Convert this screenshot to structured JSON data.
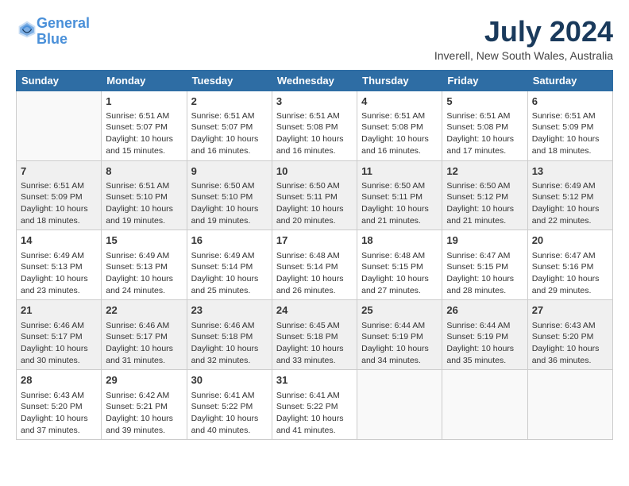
{
  "logo": {
    "line1": "General",
    "line2": "Blue"
  },
  "title": "July 2024",
  "location": "Inverell, New South Wales, Australia",
  "days_header": [
    "Sunday",
    "Monday",
    "Tuesday",
    "Wednesday",
    "Thursday",
    "Friday",
    "Saturday"
  ],
  "weeks": [
    [
      {
        "day": "",
        "info": ""
      },
      {
        "day": "1",
        "info": "Sunrise: 6:51 AM\nSunset: 5:07 PM\nDaylight: 10 hours\nand 15 minutes."
      },
      {
        "day": "2",
        "info": "Sunrise: 6:51 AM\nSunset: 5:07 PM\nDaylight: 10 hours\nand 16 minutes."
      },
      {
        "day": "3",
        "info": "Sunrise: 6:51 AM\nSunset: 5:08 PM\nDaylight: 10 hours\nand 16 minutes."
      },
      {
        "day": "4",
        "info": "Sunrise: 6:51 AM\nSunset: 5:08 PM\nDaylight: 10 hours\nand 16 minutes."
      },
      {
        "day": "5",
        "info": "Sunrise: 6:51 AM\nSunset: 5:08 PM\nDaylight: 10 hours\nand 17 minutes."
      },
      {
        "day": "6",
        "info": "Sunrise: 6:51 AM\nSunset: 5:09 PM\nDaylight: 10 hours\nand 18 minutes."
      }
    ],
    [
      {
        "day": "7",
        "info": "Sunrise: 6:51 AM\nSunset: 5:09 PM\nDaylight: 10 hours\nand 18 minutes."
      },
      {
        "day": "8",
        "info": "Sunrise: 6:51 AM\nSunset: 5:10 PM\nDaylight: 10 hours\nand 19 minutes."
      },
      {
        "day": "9",
        "info": "Sunrise: 6:50 AM\nSunset: 5:10 PM\nDaylight: 10 hours\nand 19 minutes."
      },
      {
        "day": "10",
        "info": "Sunrise: 6:50 AM\nSunset: 5:11 PM\nDaylight: 10 hours\nand 20 minutes."
      },
      {
        "day": "11",
        "info": "Sunrise: 6:50 AM\nSunset: 5:11 PM\nDaylight: 10 hours\nand 21 minutes."
      },
      {
        "day": "12",
        "info": "Sunrise: 6:50 AM\nSunset: 5:12 PM\nDaylight: 10 hours\nand 21 minutes."
      },
      {
        "day": "13",
        "info": "Sunrise: 6:49 AM\nSunset: 5:12 PM\nDaylight: 10 hours\nand 22 minutes."
      }
    ],
    [
      {
        "day": "14",
        "info": "Sunrise: 6:49 AM\nSunset: 5:13 PM\nDaylight: 10 hours\nand 23 minutes."
      },
      {
        "day": "15",
        "info": "Sunrise: 6:49 AM\nSunset: 5:13 PM\nDaylight: 10 hours\nand 24 minutes."
      },
      {
        "day": "16",
        "info": "Sunrise: 6:49 AM\nSunset: 5:14 PM\nDaylight: 10 hours\nand 25 minutes."
      },
      {
        "day": "17",
        "info": "Sunrise: 6:48 AM\nSunset: 5:14 PM\nDaylight: 10 hours\nand 26 minutes."
      },
      {
        "day": "18",
        "info": "Sunrise: 6:48 AM\nSunset: 5:15 PM\nDaylight: 10 hours\nand 27 minutes."
      },
      {
        "day": "19",
        "info": "Sunrise: 6:47 AM\nSunset: 5:15 PM\nDaylight: 10 hours\nand 28 minutes."
      },
      {
        "day": "20",
        "info": "Sunrise: 6:47 AM\nSunset: 5:16 PM\nDaylight: 10 hours\nand 29 minutes."
      }
    ],
    [
      {
        "day": "21",
        "info": "Sunrise: 6:46 AM\nSunset: 5:17 PM\nDaylight: 10 hours\nand 30 minutes."
      },
      {
        "day": "22",
        "info": "Sunrise: 6:46 AM\nSunset: 5:17 PM\nDaylight: 10 hours\nand 31 minutes."
      },
      {
        "day": "23",
        "info": "Sunrise: 6:46 AM\nSunset: 5:18 PM\nDaylight: 10 hours\nand 32 minutes."
      },
      {
        "day": "24",
        "info": "Sunrise: 6:45 AM\nSunset: 5:18 PM\nDaylight: 10 hours\nand 33 minutes."
      },
      {
        "day": "25",
        "info": "Sunrise: 6:44 AM\nSunset: 5:19 PM\nDaylight: 10 hours\nand 34 minutes."
      },
      {
        "day": "26",
        "info": "Sunrise: 6:44 AM\nSunset: 5:19 PM\nDaylight: 10 hours\nand 35 minutes."
      },
      {
        "day": "27",
        "info": "Sunrise: 6:43 AM\nSunset: 5:20 PM\nDaylight: 10 hours\nand 36 minutes."
      }
    ],
    [
      {
        "day": "28",
        "info": "Sunrise: 6:43 AM\nSunset: 5:20 PM\nDaylight: 10 hours\nand 37 minutes."
      },
      {
        "day": "29",
        "info": "Sunrise: 6:42 AM\nSunset: 5:21 PM\nDaylight: 10 hours\nand 39 minutes."
      },
      {
        "day": "30",
        "info": "Sunrise: 6:41 AM\nSunset: 5:22 PM\nDaylight: 10 hours\nand 40 minutes."
      },
      {
        "day": "31",
        "info": "Sunrise: 6:41 AM\nSunset: 5:22 PM\nDaylight: 10 hours\nand 41 minutes."
      },
      {
        "day": "",
        "info": ""
      },
      {
        "day": "",
        "info": ""
      },
      {
        "day": "",
        "info": ""
      }
    ]
  ]
}
